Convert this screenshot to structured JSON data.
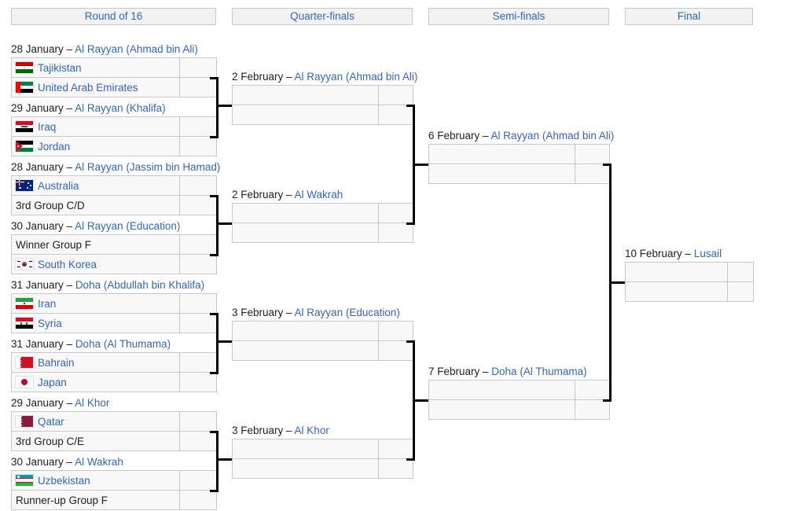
{
  "title": "Knockout stage bracket",
  "rounds": [
    {
      "id": "round-of-16",
      "label": "Round of 16"
    },
    {
      "id": "quarter-finals",
      "label": "Quarter-finals"
    },
    {
      "id": "semi-finals",
      "label": "Semi-finals"
    },
    {
      "id": "final",
      "label": "Final"
    }
  ],
  "r16": [
    {
      "date": "28 January",
      "dash": " – ",
      "venue": "Al Rayyan (Ahmad bin Ali)",
      "teams": [
        {
          "name": "Tajikistan",
          "flag": "tjk",
          "link": true,
          "score": ""
        },
        {
          "name": "United Arab Emirates",
          "flag": "uae",
          "link": true,
          "score": ""
        }
      ]
    },
    {
      "date": "29 January",
      "dash": " – ",
      "venue": "Al Rayyan (Khalifa)",
      "teams": [
        {
          "name": "Iraq",
          "flag": "irq",
          "link": true,
          "score": ""
        },
        {
          "name": "Jordan",
          "flag": "jor",
          "link": true,
          "score": ""
        }
      ]
    },
    {
      "date": "28 January",
      "dash": " – ",
      "venue": "Al Rayyan (Jassim bin Hamad)",
      "teams": [
        {
          "name": "Australia",
          "flag": "aus",
          "link": true,
          "score": ""
        },
        {
          "name": "3rd Group C/D",
          "flag": "",
          "link": false,
          "score": ""
        }
      ]
    },
    {
      "date": "30 January",
      "dash": " – ",
      "venue": "Al Rayyan (Education)",
      "teams": [
        {
          "name": "Winner Group F",
          "flag": "",
          "link": false,
          "score": ""
        },
        {
          "name": "South Korea",
          "flag": "kor",
          "link": true,
          "score": ""
        }
      ]
    },
    {
      "date": "31 January",
      "dash": " – ",
      "venue": "Doha (Abdullah bin Khalifa)",
      "teams": [
        {
          "name": "Iran",
          "flag": "irn",
          "link": true,
          "score": ""
        },
        {
          "name": "Syria",
          "flag": "syr",
          "link": true,
          "score": ""
        }
      ]
    },
    {
      "date": "31 January",
      "dash": " – ",
      "venue": "Doha (Al Thumama)",
      "teams": [
        {
          "name": "Bahrain",
          "flag": "bhr",
          "link": true,
          "score": ""
        },
        {
          "name": "Japan",
          "flag": "jpn",
          "link": true,
          "score": ""
        }
      ]
    },
    {
      "date": "29 January",
      "dash": " – ",
      "venue": "Al Khor",
      "teams": [
        {
          "name": "Qatar",
          "flag": "qat",
          "link": true,
          "score": ""
        },
        {
          "name": "3rd Group C/E",
          "flag": "",
          "link": false,
          "score": ""
        }
      ]
    },
    {
      "date": "30 January",
      "dash": " – ",
      "venue": "Al Wakrah",
      "teams": [
        {
          "name": "Uzbekistan",
          "flag": "uzb",
          "link": true,
          "score": ""
        },
        {
          "name": "Runner-up Group F",
          "flag": "",
          "link": false,
          "score": ""
        }
      ]
    }
  ],
  "qf": [
    {
      "date": "2 February",
      "dash": " – ",
      "venue": "Al Rayyan (Ahmad bin Ali)",
      "teams": [
        {
          "name": "",
          "flag": "",
          "link": false,
          "score": ""
        },
        {
          "name": "",
          "flag": "",
          "link": false,
          "score": ""
        }
      ]
    },
    {
      "date": "2 February",
      "dash": " – ",
      "venue": "Al Wakrah",
      "teams": [
        {
          "name": "",
          "flag": "",
          "link": false,
          "score": ""
        },
        {
          "name": "",
          "flag": "",
          "link": false,
          "score": ""
        }
      ]
    },
    {
      "date": "3 February",
      "dash": " – ",
      "venue": "Al Rayyan (Education)",
      "teams": [
        {
          "name": "",
          "flag": "",
          "link": false,
          "score": ""
        },
        {
          "name": "",
          "flag": "",
          "link": false,
          "score": ""
        }
      ]
    },
    {
      "date": "3 February",
      "dash": " – ",
      "venue": "Al Khor",
      "teams": [
        {
          "name": "",
          "flag": "",
          "link": false,
          "score": ""
        },
        {
          "name": "",
          "flag": "",
          "link": false,
          "score": ""
        }
      ]
    }
  ],
  "sf": [
    {
      "date": "6 February",
      "dash": " – ",
      "venue": "Al Rayyan (Ahmad bin Ali)",
      "teams": [
        {
          "name": "",
          "flag": "",
          "link": false,
          "score": ""
        },
        {
          "name": "",
          "flag": "",
          "link": false,
          "score": ""
        }
      ]
    },
    {
      "date": "7 February",
      "dash": " – ",
      "venue": "Doha (Al Thumama)",
      "teams": [
        {
          "name": "",
          "flag": "",
          "link": false,
          "score": ""
        },
        {
          "name": "",
          "flag": "",
          "link": false,
          "score": ""
        }
      ]
    }
  ],
  "final": [
    {
      "date": "10 February",
      "dash": " – ",
      "venue": "Lusail",
      "teams": [
        {
          "name": "",
          "flag": "",
          "link": false,
          "score": ""
        },
        {
          "name": "",
          "flag": "",
          "link": false,
          "score": ""
        }
      ]
    }
  ],
  "colors": {
    "link": "#3366bb",
    "header_bg": "#f2f2f2",
    "cell_bg": "#f8f8f8",
    "cell_border": "#c8c8c8",
    "connector": "#000000",
    "text": "#202122"
  }
}
